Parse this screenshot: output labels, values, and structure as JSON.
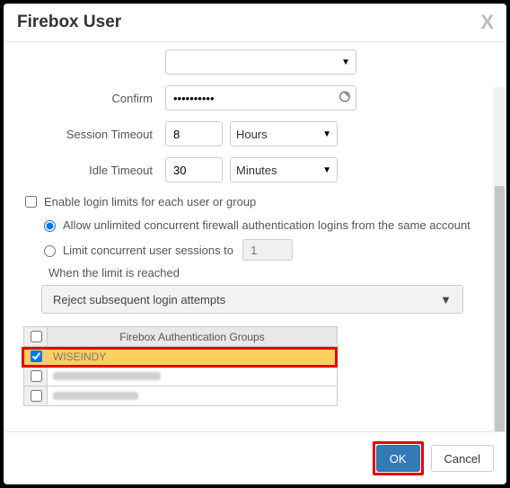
{
  "dialog": {
    "title": "Firebox User",
    "close_symbol": "X"
  },
  "form": {
    "confirm_label": "Confirm",
    "confirm_value": "••••••••••",
    "session_label": "Session Timeout",
    "session_value": "8",
    "session_unit": "Hours",
    "idle_label": "Idle Timeout",
    "idle_value": "30",
    "idle_unit": "Minutes"
  },
  "limits": {
    "enable_label": "Enable login limits for each user or group",
    "enable_checked": false,
    "allow_label": "Allow unlimited concurrent firewall authentication logins from the same account",
    "allow_selected": true,
    "limit_label": "Limit concurrent user sessions to",
    "limit_selected": false,
    "limit_value": "1",
    "reached_label": "When the limit is reached",
    "reached_action": "Reject subsequent login attempts"
  },
  "groups": {
    "header": "Firebox Authentication Groups",
    "rows": [
      {
        "name": "WISEINDY",
        "checked": true,
        "highlighted": true
      },
      {
        "name": "",
        "checked": false,
        "redacted": true
      },
      {
        "name": "",
        "checked": false,
        "redacted": true
      }
    ]
  },
  "footer": {
    "ok": "OK",
    "cancel": "Cancel"
  }
}
